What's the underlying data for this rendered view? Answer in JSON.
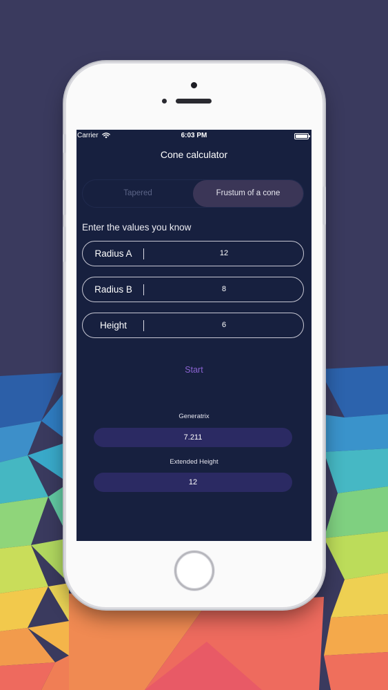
{
  "status_bar": {
    "carrier": "Carrier",
    "time": "6:03 PM"
  },
  "nav": {
    "title": "Cone calculator"
  },
  "tabs": [
    {
      "label": "Tapered",
      "selected": false
    },
    {
      "label": "Frustum of a cone",
      "selected": true
    }
  ],
  "form": {
    "prompt": "Enter the values you know",
    "fields": [
      {
        "label": "Radius A",
        "value": "12"
      },
      {
        "label": "Radius B",
        "value": "8"
      },
      {
        "label": "Height",
        "value": "6"
      }
    ]
  },
  "start_label": "Start",
  "results": [
    {
      "label": "Generatrix",
      "value": "7.211"
    },
    {
      "label": "Extended Height",
      "value": "12"
    }
  ],
  "colors": {
    "screen_bg": "#17203f",
    "accent": "#8b63d2",
    "result_pill": "#2b2a63",
    "selected_tab": "#3b3657"
  },
  "icons": [
    "wifi-icon",
    "battery-icon"
  ]
}
